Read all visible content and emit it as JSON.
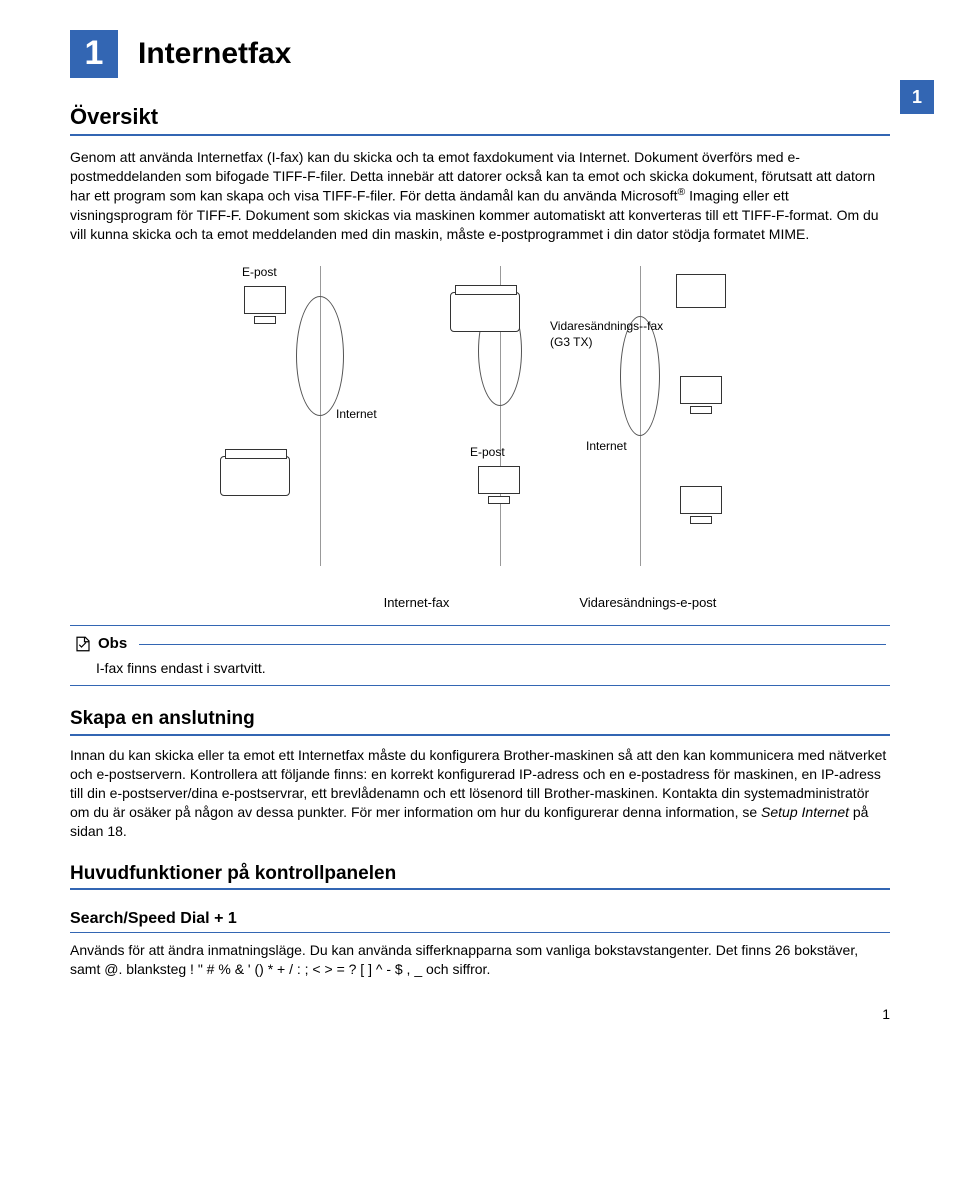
{
  "chapter": {
    "number": "1",
    "title": "Internetfax",
    "side_tab": "1"
  },
  "overview": {
    "heading": "Översikt",
    "p1a": "Genom att använda Internetfax (I-fax) kan du skicka och ta emot faxdokument via Internet. Dokument överförs med e-postmeddelanden som bifogade TIFF-F-filer. Detta innebär att datorer också kan ta emot och skicka dokument, förutsatt att datorn har ett program som kan skapa och visa TIFF-F-filer. För detta ändamål kan du använda Microsoft",
    "sup": "®",
    "p1b": " Imaging eller ett visningsprogram för TIFF-F. Dokument som skickas via maskinen kommer automatiskt att konverteras till ett TIFF-F-format. Om du vill kunna skicka och ta emot meddelanden med din maskin, måste e-postprogrammet i din dator stödja formatet MIME."
  },
  "diagram": {
    "epost": "E-post",
    "internet": "Internet",
    "relay_fax": "Vidaresändnings--fax",
    "relay_fax_sub": "(G3 TX)",
    "internet_fax": "Internet-fax",
    "relay_email": "Vidaresändnings-e-post"
  },
  "note": {
    "label": "Obs",
    "text": "I-fax finns endast i svartvitt."
  },
  "connect": {
    "heading": "Skapa en anslutning",
    "p1": "Innan du kan skicka eller ta emot ett Internetfax måste du konfigurera Brother-maskinen så att den kan kommunicera med nätverket och e-postservern. Kontrollera att följande finns: en korrekt konfigurerad IP-adress och en e-postadress för maskinen, en IP-adress till din e-postserver/dina e-postservrar, ett brevlådenamn och ett lösenord till Brother-maskinen. Kontakta din systemadministratör om du är osäker på någon av dessa punkter. För mer information om hur du konfigurerar denna information, se ",
    "p1_link": "Setup Internet",
    "p1_tail": " på sidan 18."
  },
  "panel": {
    "heading": "Huvudfunktioner på kontrollpanelen",
    "sub": "Search/Speed Dial + 1",
    "p": "Används för att ändra inmatningsläge. Du kan använda sifferknapparna som vanliga bokstavstangenter. Det finns 26 bokstäver, samt @. blanksteg ! \" # % & ' () * + / : ; < > = ? [ ] ^ - $ , _ och siffror."
  },
  "page": "1"
}
